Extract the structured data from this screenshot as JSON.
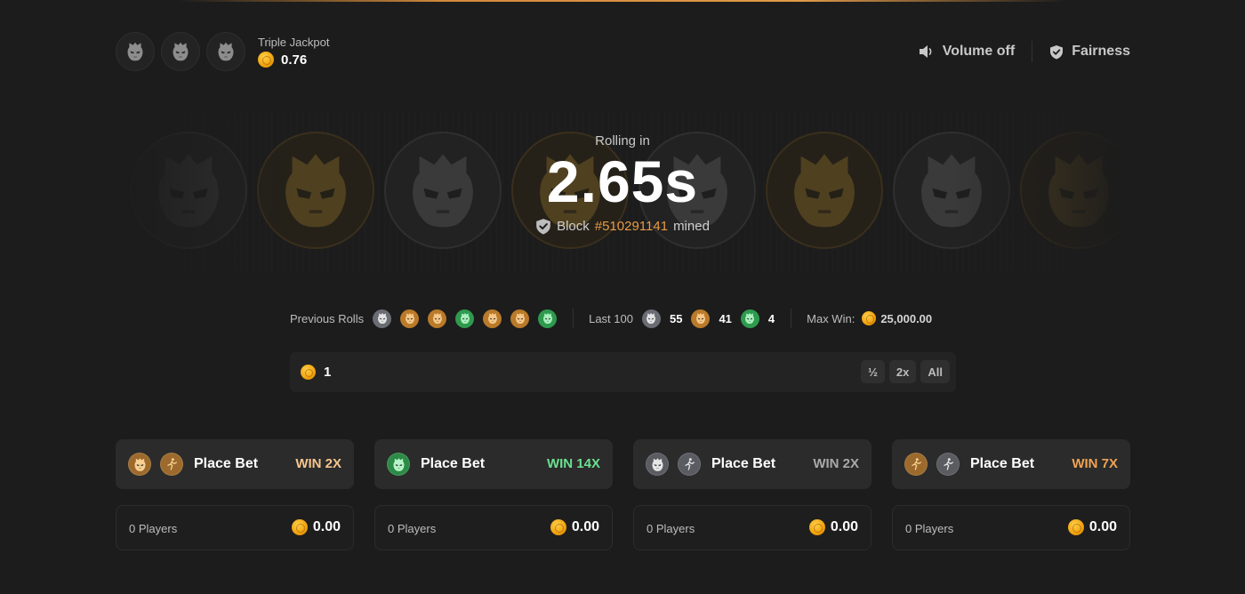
{
  "jackpot": {
    "title": "Triple Jackpot",
    "amount": "0.76",
    "icons": [
      "bandit-mask-icon",
      "bandit-mask-icon",
      "bandit-mask-icon"
    ]
  },
  "header": {
    "volume_label": "Volume off",
    "fairness_label": "Fairness"
  },
  "roller": {
    "label": "Rolling in",
    "timer": "2.65s",
    "block_prefix": "Block",
    "block_number": "#510291141",
    "block_suffix": "mined"
  },
  "stats": {
    "previous_label": "Previous Rolls",
    "previous_rolls": [
      "gray",
      "gold",
      "gold",
      "green",
      "gold",
      "gold",
      "green"
    ],
    "last100_label": "Last 100",
    "last100": [
      {
        "color": "gray",
        "count": "55"
      },
      {
        "color": "gold",
        "count": "41"
      },
      {
        "color": "green",
        "count": "4"
      }
    ],
    "maxwin_label": "Max Win:",
    "maxwin_value": "25,000.00"
  },
  "bet_input": {
    "value": "1",
    "half_label": "½",
    "double_label": "2x",
    "all_label": "All"
  },
  "bets": [
    {
      "place_label": "Place Bet",
      "win": "WIN 2X",
      "win_color": "#f5c58f",
      "icons": [
        "gold-mask-icon",
        "terrorist-icon"
      ],
      "players": "0 Players",
      "amount": "0.00"
    },
    {
      "place_label": "Place Bet",
      "win": "WIN 14X",
      "win_color": "#6be08f",
      "icons": [
        "green-mask-icon"
      ],
      "players": "0 Players",
      "amount": "0.00"
    },
    {
      "place_label": "Place Bet",
      "win": "WIN 2X",
      "win_color": "#a9a9a9",
      "icons": [
        "gray-mask-icon",
        "counter-terrorist-icon"
      ],
      "players": "0 Players",
      "amount": "0.00"
    },
    {
      "place_label": "Place Bet",
      "win": "WIN 7X",
      "win_color": "#f0a354",
      "icons": [
        "terrorist-icon",
        "counter-terrorist-icon"
      ],
      "players": "0 Players",
      "amount": "0.00"
    }
  ],
  "colors": {
    "gold": "#e79b45",
    "accent_gray": "#6b6d74",
    "accent_green": "#2f9a4e",
    "background": "#1c1c1c"
  }
}
